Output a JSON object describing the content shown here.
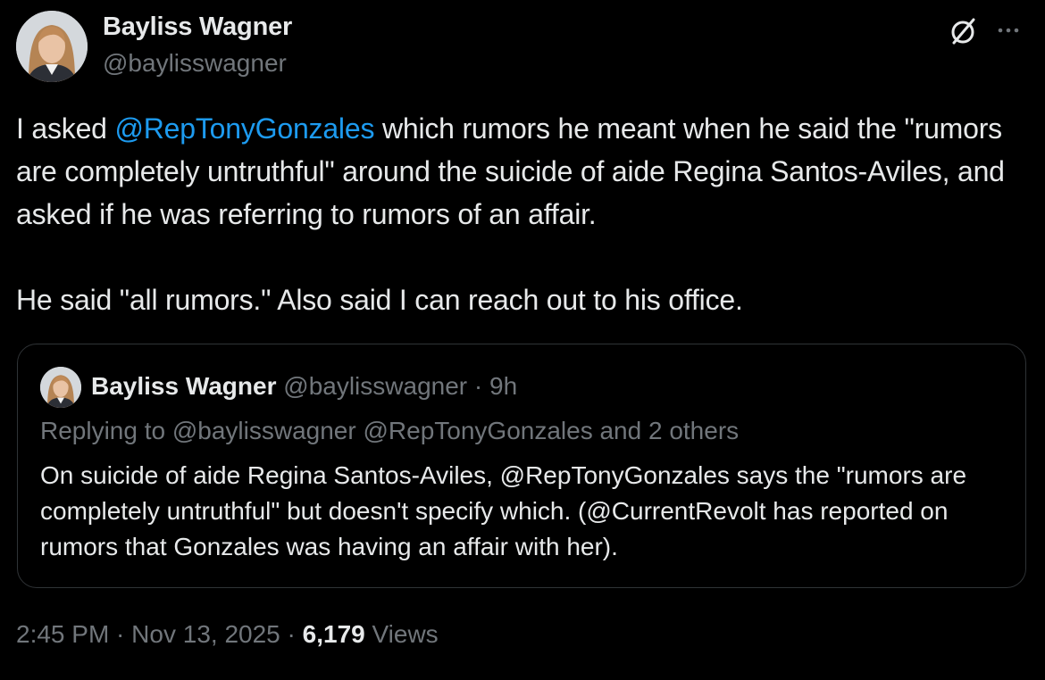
{
  "author": {
    "name": "Bayliss Wagner",
    "handle": "@baylisswagner"
  },
  "icons": {
    "grok": "grok-slash-circle-icon",
    "more": "more-horizontal-icon"
  },
  "tweet": {
    "lines": [
      {
        "pre": "I asked ",
        "mention": "@RepTonyGonzales",
        "post": " which rumors he meant when he said the \"rumors are completely untruthful\" around the suicide of aide Regina Santos-Aviles, and asked if he was referring to rumors of an affair."
      }
    ],
    "second_paragraph": "He said \"all rumors.\" Also said I can reach out to his office."
  },
  "quote": {
    "name": "Bayliss Wagner",
    "handle": "@baylisswagner",
    "separator": "·",
    "time": "9h",
    "replying_to": "Replying to @baylisswagner @RepTonyGonzales and 2 others",
    "text": "On suicide of aide Regina Santos-Aviles, @RepTonyGonzales says the \"rumors are completely untruthful\" but doesn't specify which. (@CurrentRevolt has reported on rumors that Gonzales was having an affair with her)."
  },
  "meta": {
    "time": "2:45 PM",
    "sep1": " · ",
    "date": "Nov 13, 2025",
    "sep2": " · ",
    "views_count": "6,179",
    "views_label": " Views"
  },
  "colors": {
    "background": "#000000",
    "text": "#e7e9ea",
    "secondary": "#71767b",
    "link": "#1d9bf0",
    "border": "#2f3336"
  }
}
